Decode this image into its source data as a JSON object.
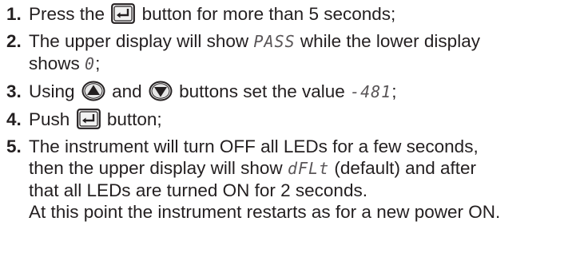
{
  "steps": [
    {
      "number": "1.",
      "before": "Press the",
      "icon": "enter-key-icon",
      "after": "button for more than 5 seconds;"
    },
    {
      "number": "2.",
      "before": "The upper display will show",
      "display1": "PASS",
      "middle": "while the lower display",
      "line2_before": "shows",
      "display2": "0",
      "line2_after": ";"
    },
    {
      "number": "3.",
      "before": "Using",
      "icon_up": "up-arrow-button-icon",
      "middle": "and",
      "icon_down": "down-arrow-button-icon",
      "after": "buttons set the value",
      "display": "-481",
      "end": ";"
    },
    {
      "number": "4.",
      "before": "Push",
      "icon": "enter-key-icon",
      "after": "button;"
    },
    {
      "number": "5.",
      "line1": "The instrument will turn OFF all LEDs for a few seconds,",
      "line2_before": "then the upper display will show",
      "display": "dFLt",
      "line2_after": "(default) and after",
      "line3": "that all LEDs are turned ON for 2 seconds.",
      "line4": "At this point the instrument restarts as for a new power ON."
    }
  ]
}
